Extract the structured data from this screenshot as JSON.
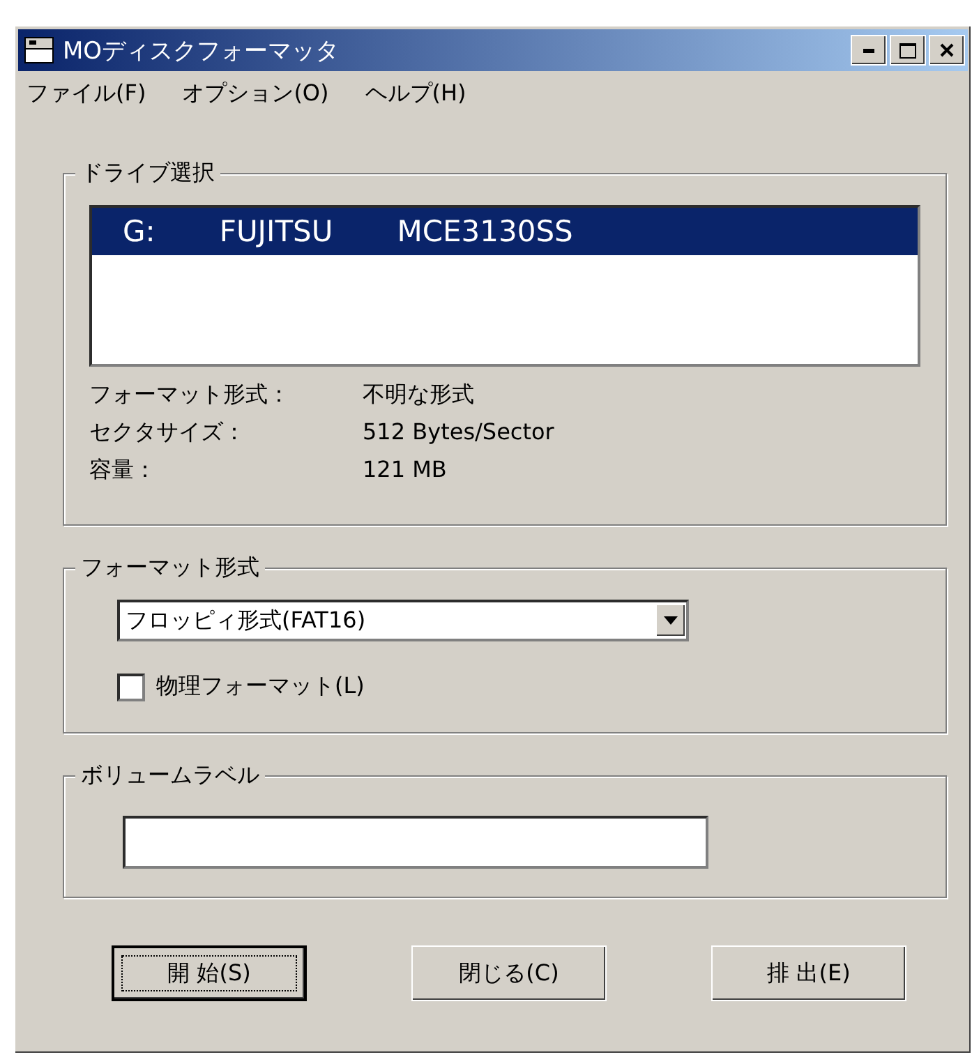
{
  "window": {
    "title": "MOディスクフォーマッタ"
  },
  "menu": [
    {
      "label": "ファイル(F)"
    },
    {
      "label": "オプション(O)"
    },
    {
      "label": "ヘルプ(H)"
    }
  ],
  "drive_group": {
    "label": "ドライブ選択",
    "drives": [
      {
        "letter": "G:",
        "vendor": "FUJITSU",
        "model": "MCE3130SS",
        "selected": true
      }
    ],
    "info": [
      {
        "label": "フォーマット形式：",
        "value": "不明な形式"
      },
      {
        "label": "セクタサイズ：",
        "value": "512 Bytes/Sector"
      },
      {
        "label": "容量：",
        "value": "121 MB"
      }
    ]
  },
  "format_group": {
    "label": "フォーマット形式",
    "dropdown": {
      "value": "フロッピィ形式(FAT16)"
    },
    "checkbox": {
      "label": "物理フォーマット(L)",
      "checked": false
    }
  },
  "volume_group": {
    "label": "ボリュームラベル"
  },
  "buttons": [
    {
      "label": "開 始(S)",
      "default": true
    },
    {
      "label": "閉じる(C)",
      "default": false
    },
    {
      "label": "排 出(E)",
      "default": false
    }
  ]
}
